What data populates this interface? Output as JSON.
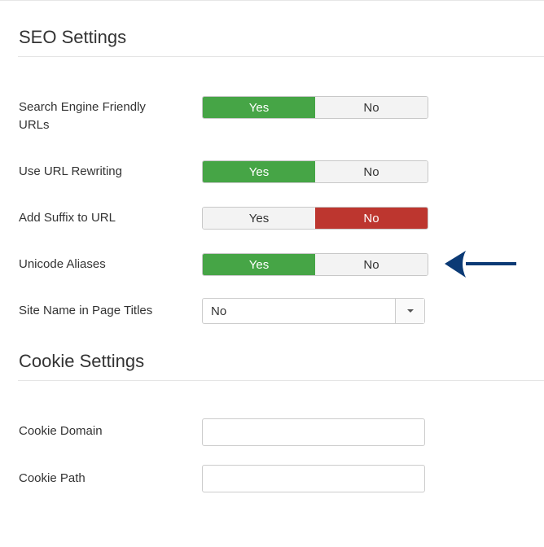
{
  "seo": {
    "title": "SEO Settings",
    "rows": [
      {
        "label": "Search Engine Friendly URLs",
        "yes": "Yes",
        "no": "No",
        "value": "Yes"
      },
      {
        "label": "Use URL Rewriting",
        "yes": "Yes",
        "no": "No",
        "value": "Yes"
      },
      {
        "label": "Add Suffix to URL",
        "yes": "Yes",
        "no": "No",
        "value": "No"
      },
      {
        "label": "Unicode Aliases",
        "yes": "Yes",
        "no": "No",
        "value": "Yes"
      }
    ],
    "site_name": {
      "label": "Site Name in Page Titles",
      "value": "No"
    }
  },
  "cookie": {
    "title": "Cookie Settings",
    "domain": {
      "label": "Cookie Domain",
      "value": ""
    },
    "path": {
      "label": "Cookie Path",
      "value": ""
    }
  },
  "colors": {
    "yes_active": "#46a546",
    "no_active": "#bd362f",
    "arrow": "#0b3a75"
  },
  "annotation": {
    "icon": "arrow-left-icon"
  }
}
